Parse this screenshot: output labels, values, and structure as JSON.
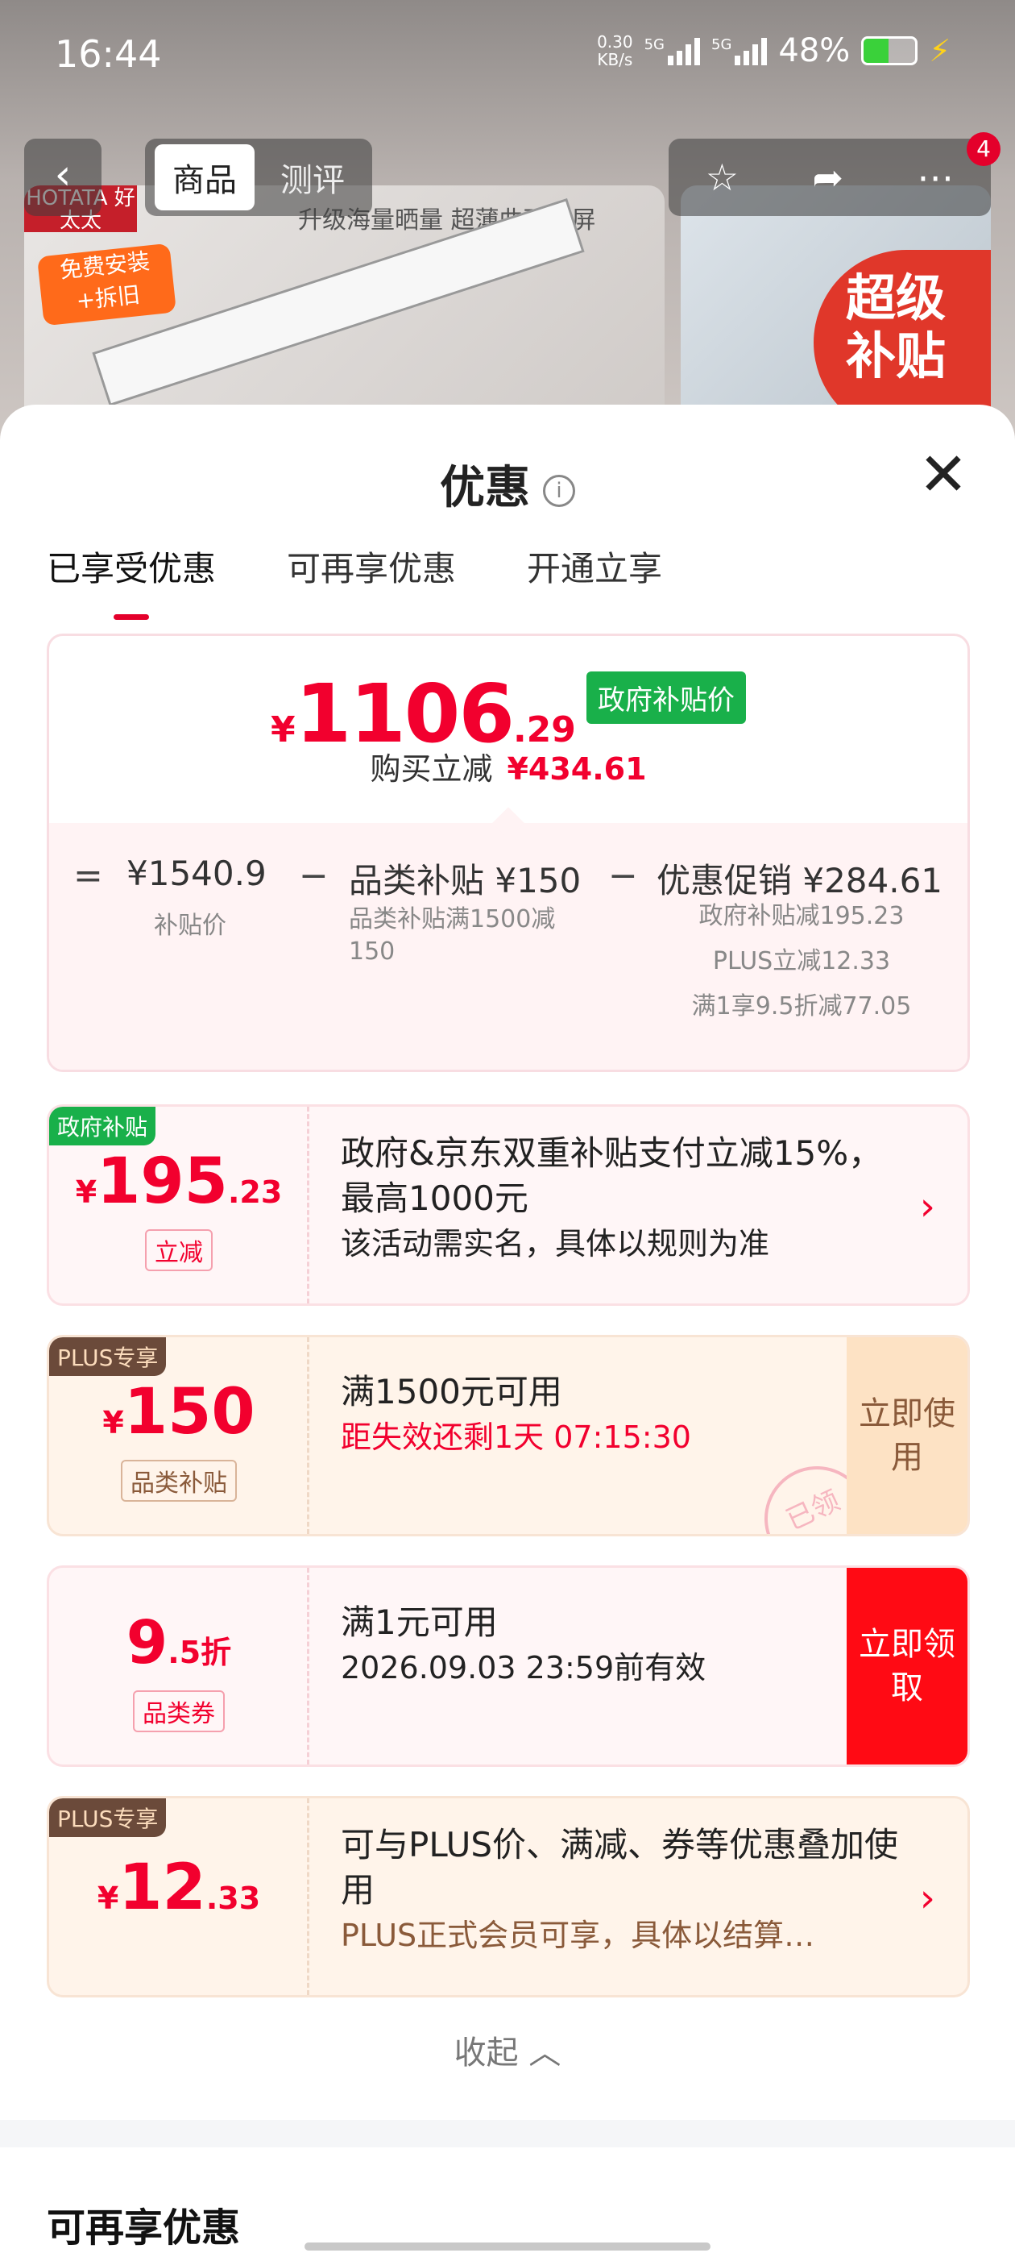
{
  "status_bar": {
    "time": "16:44",
    "speed_value": "0.30",
    "speed_unit": "KB/s",
    "net1": "5G",
    "net2": "5G",
    "battery_pct": "48%",
    "battery_level": 0.48
  },
  "nav": {
    "tabs": [
      "商品",
      "测评"
    ],
    "active_tab": 0,
    "badge": "4"
  },
  "product": {
    "brand": "HOTATA 好太太",
    "install_badge": "免费安装 +拆旧",
    "slogan": "升级海量晒量 超薄曲面全屏",
    "super_badge": "超级 补贴"
  },
  "sheet": {
    "title": "优惠",
    "tabs": [
      "已享受优惠",
      "可再享优惠",
      "开通立享"
    ],
    "active_tab": 0,
    "final_price": {
      "currency": "¥",
      "integer": "1106",
      "decimal": ".29",
      "tag": "政府补贴价"
    },
    "reduce_label": "购买立减",
    "reduce_amount": "¥434.61",
    "breakdown": {
      "eq": "=",
      "minus": "−",
      "subsidy_price": "¥1540.9",
      "subsidy_price_label": "补贴价",
      "category_subsidy": "品类补贴 ¥150",
      "category_subsidy_desc": "品类补贴满1500减150",
      "promo": "优惠促销 ¥284.61",
      "promo_lines": [
        "政府补贴减195.23",
        "PLUS立减12.33",
        "满1享9.5折减77.05"
      ]
    },
    "coupons": [
      {
        "tag": "政府补贴",
        "currency": "¥",
        "amount": "195",
        "decimal": ".23",
        "sub": "立减",
        "line1": "政府&京东双重补贴支付立减15%，最高1000元",
        "line2": "该活动需实名，具体以规则为准",
        "arrow": "›"
      },
      {
        "tag": "PLUS专享",
        "currency": "¥",
        "amount": "150",
        "decimal": "",
        "sub": "品类补贴",
        "line1": "满1500元可用",
        "line2": "距失效还剩1天 07:15:30",
        "button": "立即使用",
        "stamp": "已领"
      },
      {
        "tag": "",
        "currency": "",
        "amount": "9",
        "decimal": ".5折",
        "sub": "品类券",
        "line1": "满1元可用",
        "line2": "2026.09.03 23:59前有效",
        "button": "立即领取"
      },
      {
        "tag": "PLUS专享",
        "currency": "¥",
        "amount": "12",
        "decimal": ".33",
        "sub": "",
        "line1": "可与PLUS价、满减、券等优惠叠加使用",
        "line2": "PLUS正式会员可享，具体以结算…",
        "arrow": "›"
      }
    ],
    "collapse_label": "收起",
    "section2_title": "可再享优惠"
  },
  "colors": {
    "red": "#f2002e",
    "green": "#19b04a",
    "plus_brown": "#6b4a3a",
    "plus_bg": "#fff2e6"
  }
}
